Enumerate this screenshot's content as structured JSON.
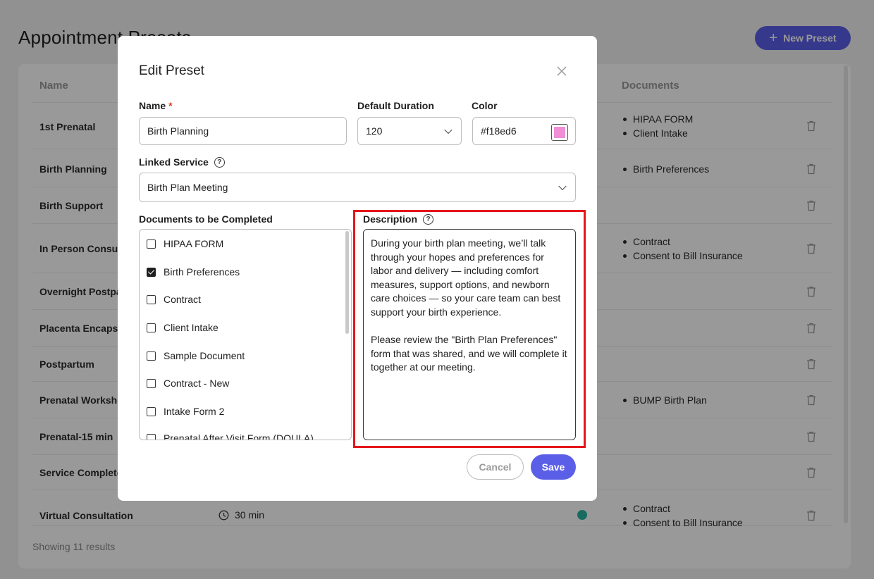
{
  "page": {
    "title": "Appointment Presets",
    "new_preset_label": "New Preset",
    "columns": {
      "name": "Name",
      "documents": "Documents"
    },
    "rows": [
      {
        "name": "1st Prenatal",
        "documents": [
          "HIPAA FORM",
          "Client Intake"
        ]
      },
      {
        "name": "Birth Planning",
        "documents": [
          "Birth Preferences"
        ]
      },
      {
        "name": "Birth Support",
        "documents": []
      },
      {
        "name": "In Person Consultation",
        "documents": [
          "Contract",
          "Consent to Bill Insurance"
        ]
      },
      {
        "name": "Overnight Postpartum",
        "documents": []
      },
      {
        "name": "Placenta Encapsulation",
        "documents": []
      },
      {
        "name": "Postpartum",
        "documents": []
      },
      {
        "name": "Prenatal Workshop",
        "documents": [
          "BUMP Birth Plan"
        ]
      },
      {
        "name": "Prenatal-15 min",
        "documents": []
      },
      {
        "name": "Service Completed",
        "documents": []
      },
      {
        "name": "Virtual Consultation",
        "duration": "30 min",
        "documents": [
          "Contract",
          "Consent to Bill Insurance"
        ]
      }
    ],
    "footer": "Showing 11 results"
  },
  "modal": {
    "title": "Edit Preset",
    "name_label": "Name",
    "required_mark": "*",
    "name_value": "Birth Planning",
    "duration_label": "Default Duration",
    "duration_value": "120",
    "color_label": "Color",
    "color_value": "#f18ed6",
    "linked_service_label": "Linked Service",
    "linked_service_value": "Birth Plan Meeting",
    "documents_label": "Documents to be Completed",
    "documents": [
      {
        "label": "HIPAA FORM",
        "checked": false
      },
      {
        "label": "Birth Preferences",
        "checked": true
      },
      {
        "label": "Contract",
        "checked": false
      },
      {
        "label": "Client Intake",
        "checked": false
      },
      {
        "label": "Sample Document",
        "checked": false
      },
      {
        "label": "Contract - New",
        "checked": false
      },
      {
        "label": "Intake Form 2",
        "checked": false
      },
      {
        "label": "Prenatal After Visit Form (DOULA)",
        "checked": false
      }
    ],
    "description_label": "Description",
    "description_value": "During your birth plan meeting, we’ll talk through your hopes and preferences for labor and delivery — including comfort measures, support options, and newborn care choices — so your care team can best support your birth experience.\n\nPlease review the \"Birth Plan Preferences\" form that was shared, and we will complete it together at our meeting.",
    "cancel_label": "Cancel",
    "save_label": "Save"
  },
  "colors": {
    "accent": "#5b5fe8",
    "highlight": "#e5161c",
    "status_dot": "#2bb3a0"
  }
}
